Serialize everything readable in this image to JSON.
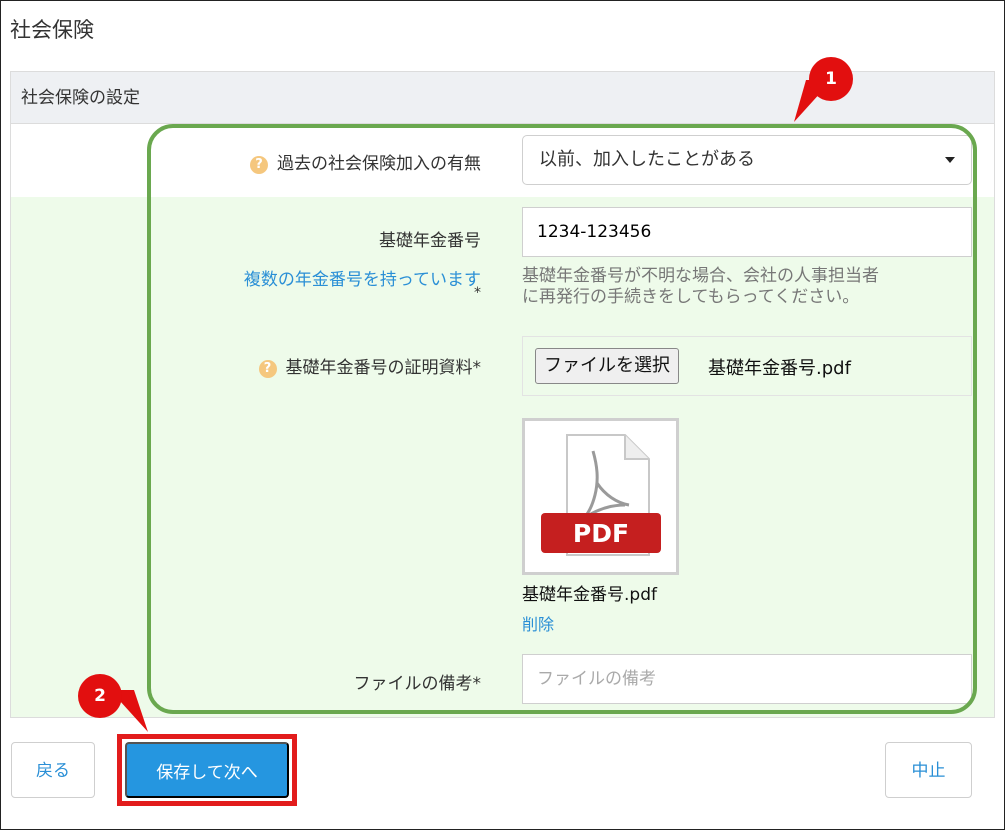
{
  "page": {
    "title": "社会保険"
  },
  "section": {
    "title": "社会保険の設定"
  },
  "form": {
    "past_enrollment": {
      "label": "過去の社会保険加入の有無",
      "value": "以前、加入したことがある"
    },
    "pension_number": {
      "label": "基礎年金番号",
      "value": "1234-123456",
      "multiple_link": "複数の年金番号を持っています",
      "asterisk": "*",
      "help_line1": "基礎年金番号が不明な場合、会社の人事担当者",
      "help_line2": "に再発行の手続きをしてもらってください。"
    },
    "proof_doc": {
      "label": "基礎年金番号の証明資料*",
      "choose_button": "ファイルを選択",
      "chosen_file": "基礎年金番号.pdf",
      "thumb_badge": "PDF",
      "uploaded_name": "基礎年金番号.pdf",
      "delete_link": "削除"
    },
    "file_note": {
      "label": "ファイルの備考*",
      "placeholder": "ファイルの備考"
    }
  },
  "buttons": {
    "back": "戻る",
    "save_next": "保存して次へ",
    "cancel": "中止"
  },
  "annotations": {
    "badge1": "1",
    "badge2": "2"
  },
  "colors": {
    "accent": "#2596e0",
    "highlight_green": "#6aa84f",
    "annotation_red": "#e20f0f",
    "form_bg": "#eefbea"
  },
  "icons": {
    "help": "question-circle-icon",
    "select_caret": "caret-down-icon",
    "document": "pdf-file-icon"
  }
}
